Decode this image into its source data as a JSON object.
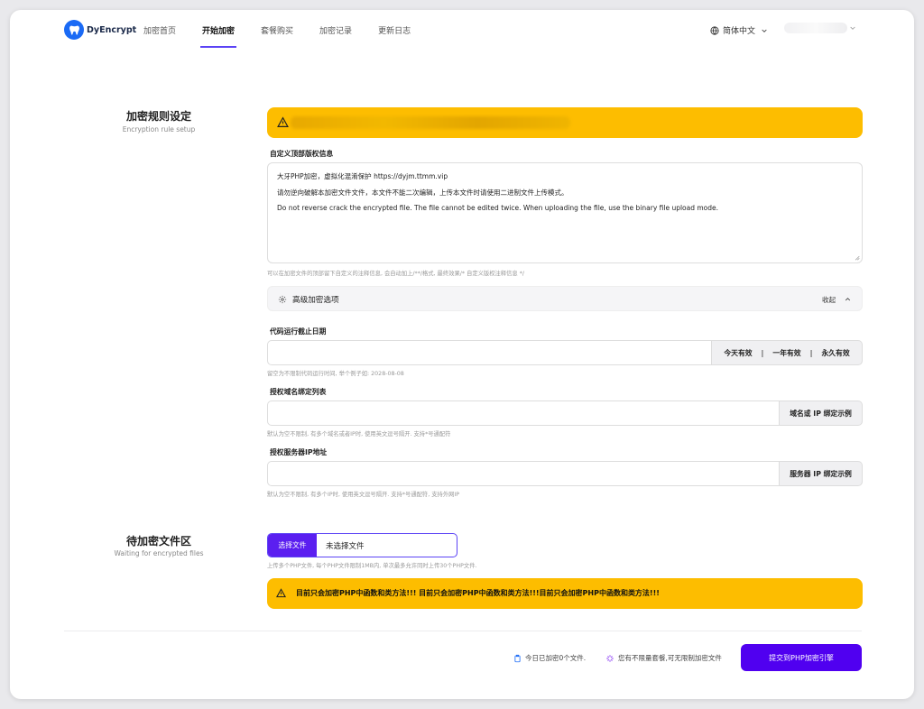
{
  "brand": {
    "name": "DyEncrypt",
    "color": "#1a6af5"
  },
  "nav": {
    "tabs": [
      {
        "label": "加密首页"
      },
      {
        "label": "开始加密"
      },
      {
        "label": "套餐购买"
      },
      {
        "label": "加密记录"
      },
      {
        "label": "更新日志"
      }
    ],
    "active_tab": "开始加密",
    "language": "简体中文"
  },
  "rules_section": {
    "title": "加密规则设定",
    "subtitle": "Encryption rule setup"
  },
  "copyright": {
    "label": "自定义顶部版权信息",
    "lines": [
      "大牙PHP加密，虚拟化混淆保护 https://dyjm.ttmm.vip",
      "请勿逆向破解本加密文件文件，本文件不能二次编辑，上传本文件时请使用二进制文件上传模式。",
      "Do not reverse crack the encrypted file. The file cannot be edited twice. When uploading the file, use the binary file upload mode."
    ],
    "hint": "可以在加密文件的顶部留下自定义的注释信息, 会自动加上/**/格式, 最终效果/* 自定义版权注释信息 */"
  },
  "advanced": {
    "title": "高级加密选项",
    "toggle_label": "收起"
  },
  "expiry": {
    "label": "代码运行截止日期",
    "value": "",
    "options": [
      "今天有效",
      "一年有效",
      "永久有效"
    ],
    "separator": "|",
    "hint": "留空为不限制代码运行时间, 举个例子如: 2028-08-08"
  },
  "domains": {
    "label": "授权域名绑定列表",
    "value": "",
    "example_button": "域名或 IP 绑定示例",
    "hint": "默认为空不限制, 有多个域名或者IP时, 使用英文逗号隔开. 支持*号通配符"
  },
  "server_ip": {
    "label": "授权服务器IP地址",
    "value": "",
    "example_button": "服务器 IP 绑定示例",
    "hint": "默认为空不限制, 有多个IP时, 使用英文逗号隔开. 支持*号通配符, 支持外网IP"
  },
  "files_section": {
    "title": "待加密文件区",
    "subtitle": "Waiting for encrypted files",
    "choose_button": "选择文件",
    "no_file": "未选择文件",
    "hint": "上传多个PHP文件, 每个PHP文件限制1MB内, 单次最多允许同时上传30个PHP文件.",
    "warning": "目前只会加密PHP中函数和类方法!!! 目前只会加密PHP中函数和类方法!!!目前只会加密PHP中函数和类方法!!!"
  },
  "footer": {
    "today_count": "今日已加密0个文件.",
    "plan_status": "您有不限量套餐,可无限制加密文件",
    "submit": "提交到PHP加密引擎"
  },
  "colors": {
    "accent": "#5000f0",
    "warning": "#fdbd00"
  }
}
